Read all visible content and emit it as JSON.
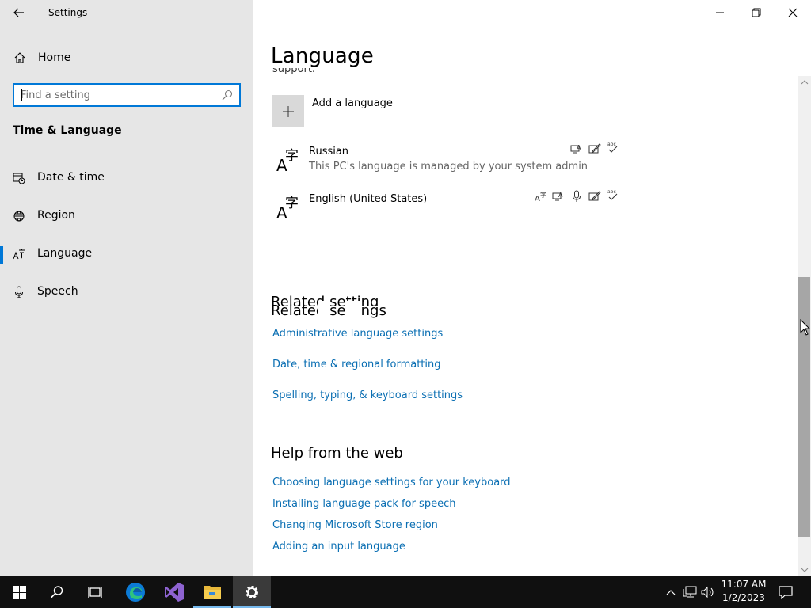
{
  "window": {
    "title": "Settings"
  },
  "sidebar": {
    "home_label": "Home",
    "search_placeholder": "Find a setting",
    "section_title": "Time & Language",
    "items": [
      {
        "label": "Date & time",
        "icon": "calendar-clock-icon"
      },
      {
        "label": "Region",
        "icon": "globe-icon"
      },
      {
        "label": "Language",
        "icon": "language-icon",
        "active": true
      },
      {
        "label": "Speech",
        "icon": "microphone-icon"
      }
    ]
  },
  "main": {
    "page_title": "Language",
    "cut_text": "support.",
    "add_language_label": "Add a language",
    "languages": [
      {
        "name": "Russian",
        "sub": "This PC's language is managed by your system admin",
        "features": [
          "display-language-icon",
          "handwriting-icon",
          "spellcheck-icon"
        ]
      },
      {
        "name": "English (United States)",
        "sub": "",
        "features": [
          "language-pack-icon",
          "display-language-icon",
          "speech-icon",
          "handwriting-icon",
          "spellcheck-icon"
        ]
      }
    ],
    "related_ghost": "Related setting",
    "related_title": "Related settings",
    "related_links": [
      "Administrative language settings",
      "Date, time & regional formatting",
      "Spelling, typing, & keyboard settings"
    ],
    "help_title": "Help from the web",
    "help_links": [
      "Choosing language settings for your keyboard",
      "Installing language pack for speech",
      "Changing Microsoft Store region",
      "Adding an input language"
    ]
  },
  "taskbar": {
    "apps": [
      "start-icon",
      "search-icon",
      "task-view-icon",
      "edge-icon",
      "visual-studio-icon",
      "file-explorer-icon",
      "settings-icon"
    ],
    "time": "11:07 AM",
    "date": "1/2/2023"
  },
  "colors": {
    "accent": "#0078d7",
    "link": "#0b6fb3",
    "sidebar_bg": "#e6e6e6",
    "taskbar_bg": "#101010"
  }
}
